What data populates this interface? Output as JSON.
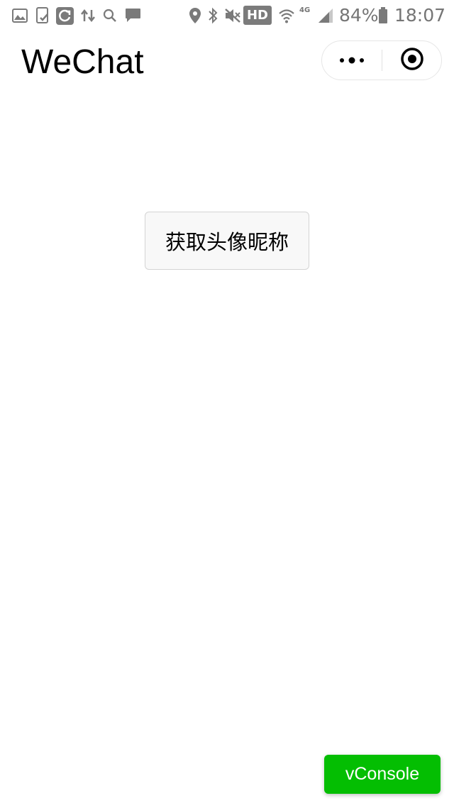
{
  "status_bar": {
    "network_badge": "HD",
    "network_type": "4G",
    "battery": "84%",
    "time": "18:07",
    "icons_left": [
      "gallery-icon",
      "tablet-check-icon",
      "sync-icon",
      "data-transfer-icon",
      "search-icon",
      "message-icon"
    ],
    "icons_right": [
      "location-icon",
      "bluetooth-icon",
      "mute-icon",
      "wifi-icon",
      "signal-icon",
      "battery-icon"
    ]
  },
  "nav": {
    "title": "WeChat",
    "more_icon": "more-dots-icon",
    "close_icon": "close-circle-icon"
  },
  "main": {
    "button_label": "获取头像昵称"
  },
  "vconsole": {
    "label": "vConsole",
    "color": "#04be02"
  }
}
